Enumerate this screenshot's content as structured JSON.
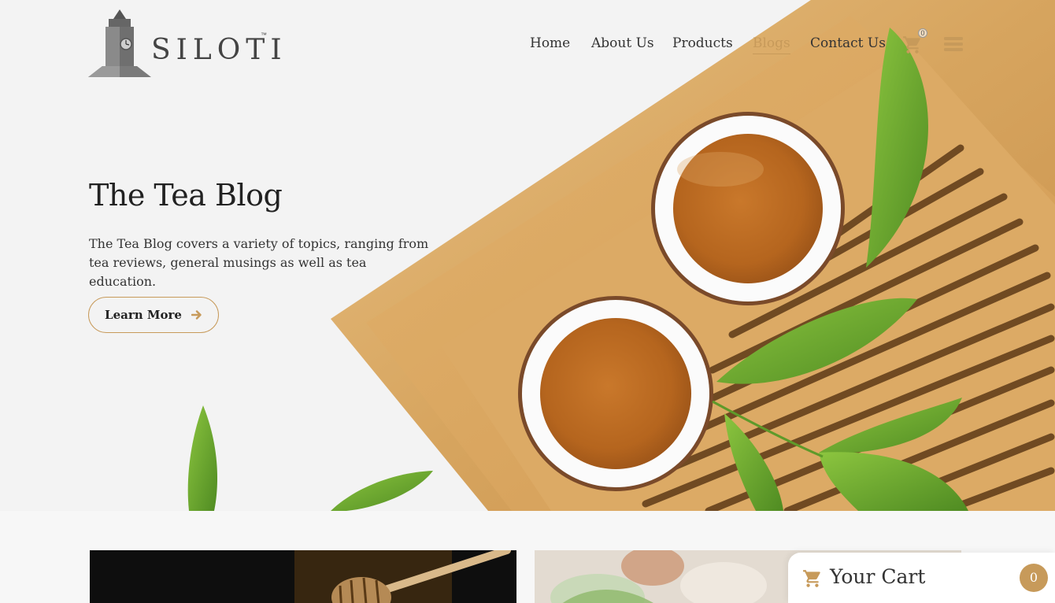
{
  "brand": {
    "name": "SILOTI",
    "trademark": "™"
  },
  "nav": {
    "items": [
      {
        "label": "Home",
        "active": false
      },
      {
        "label": "About Us",
        "active": false
      },
      {
        "label": "Products",
        "active": false
      },
      {
        "label": "Blogs",
        "active": true
      },
      {
        "label": "Contact Us",
        "active": false
      }
    ],
    "cart_count": "0",
    "icons": [
      "cart-icon",
      "menu-icon"
    ]
  },
  "hero": {
    "title": "The Tea Blog",
    "description": "The Tea Blog covers a variety of topics, ranging from tea reviews, general musings as well as tea education.",
    "button_label": "Learn More"
  },
  "cart_panel": {
    "title": "Your Cart",
    "badge_count": "0"
  },
  "colors": {
    "accent": "#c79a5a",
    "text": "#2b2b2b",
    "background": "#f7f7f7",
    "leaf": "#6aa532",
    "wood": "#d9a662",
    "tea": "#b8651f"
  }
}
